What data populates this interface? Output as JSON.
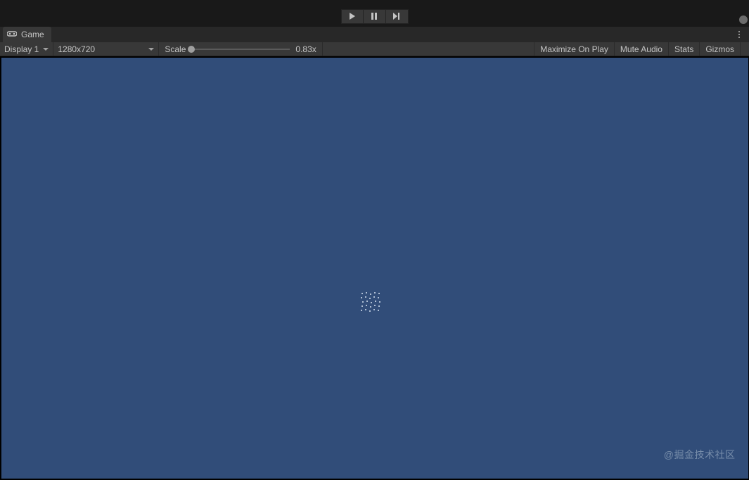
{
  "playback": {
    "play_icon": "play-icon",
    "pause_icon": "pause-icon",
    "step_icon": "step-icon"
  },
  "tab": {
    "label": "Game"
  },
  "options": {
    "display_label": "Display 1",
    "resolution_label": "1280x720",
    "scale_label": "Scale",
    "scale_value": "0.83x",
    "maximize_label": "Maximize On Play",
    "mute_label": "Mute Audio",
    "stats_label": "Stats",
    "gizmos_label": "Gizmos"
  },
  "watermark": {
    "text": "@掘金技术社区"
  }
}
